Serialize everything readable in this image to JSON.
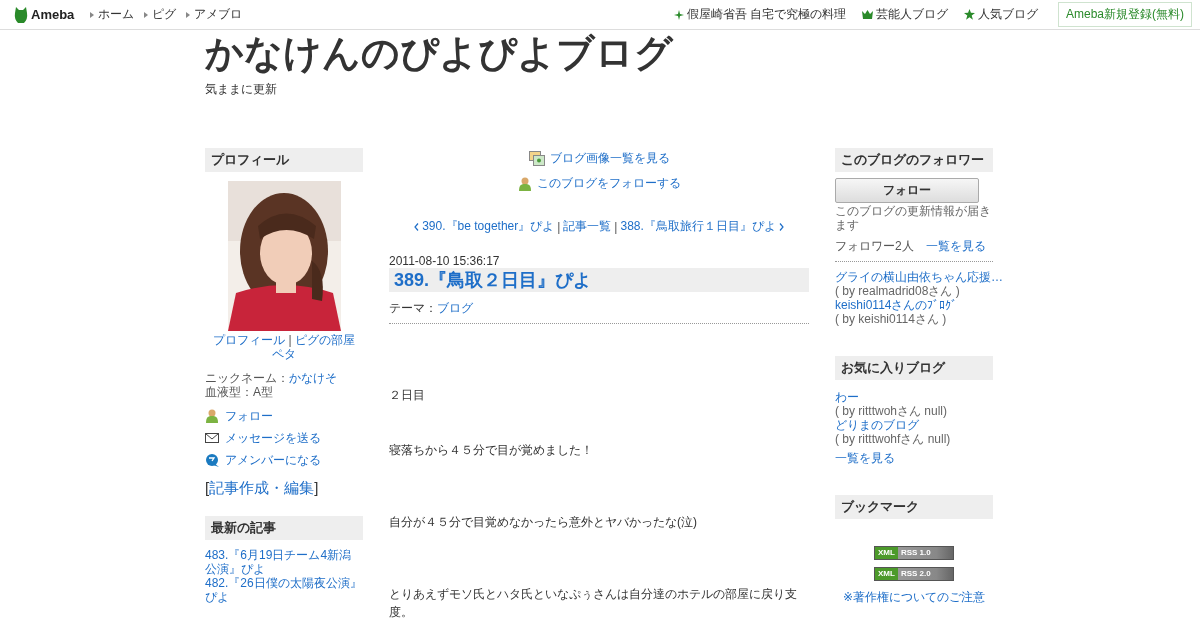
{
  "top_bar": {
    "logo": "Ameba",
    "nav": [
      "ホーム",
      "ピグ",
      "アメブロ"
    ],
    "links": [
      {
        "kind": "sparkle",
        "label": "假屋崎省吾 自宅で究極の料理"
      },
      {
        "kind": "crown",
        "label": "芸能人ブログ"
      },
      {
        "kind": "star",
        "label": "人気ブログ"
      }
    ],
    "signup": "Ameba新規登録(無料)"
  },
  "blog": {
    "title": "かなけんのぴよぴよブログ",
    "subtitle": "気ままに更新"
  },
  "profile": {
    "heading": "プロフィール",
    "photo": {
      "kind": "picture"
    },
    "links": [
      "プロフィール",
      "ピグの部屋"
    ],
    "separator": "|",
    "peta": "ペタ",
    "nickname_label": "ニックネーム：",
    "nickname": "かなけそ",
    "blood": "血液型：A型",
    "actions": [
      {
        "kind": "follow",
        "label": "フォロー"
      },
      {
        "kind": "message",
        "label": "メッセージを送る"
      },
      {
        "kind": "amember",
        "label": "アメンバーになる"
      }
    ],
    "edit": {
      "open": "[",
      "label": "記事作成・編集",
      "close": "]"
    }
  },
  "latest": {
    "heading": "最新の記事",
    "items": [
      "483.『6月19日チーム4新潟公演』ぴよ",
      "482.『26日僕の太陽夜公演』ぴよ"
    ]
  },
  "center": {
    "image_list_link": "ブログ画像一覧を見る",
    "follow_link": "このブログをフォローする",
    "pager": {
      "prev": "390.『be together』ぴよ",
      "separator": "|",
      "index": "記事一覧",
      "next": "388.『鳥取旅行１日目』ぴよ"
    },
    "post": {
      "date": "2011-08-10 15:36:17",
      "title": "389.『鳥取２日目』ぴよ",
      "theme_label": "テーマ：",
      "theme": "ブログ",
      "paragraphs": [
        "２日目",
        "寝落ちから４５分で目が覚めました！",
        "自分が４５分で目覚めなかったら意外とヤバかったな(泣)",
        "とりあえずモソ氏とハタ氏といなぷぅさんは自分達のホテルの部屋に戻り支度。"
      ]
    }
  },
  "followers": {
    "heading": "このブログのフォロワー",
    "button": "フォロー",
    "note": "このブログの更新情報が届きます",
    "count": "フォロワー2人",
    "see_all": "一覧を見る",
    "items": [
      {
        "title": "グライの横山由依ちゃん応援…",
        "by": "( by realmadrid08さん )"
      },
      {
        "title": "keishi0114さんのﾌﾞﾛｸﾞ",
        "by": "( by keishi0114さん )"
      }
    ]
  },
  "favorites": {
    "heading": "お気に入りブログ",
    "items": [
      {
        "title": "わー",
        "by": "( by ritttwohさん null)"
      },
      {
        "title": "どりまのブログ",
        "by": "( by ritttwohfさん null)"
      }
    ],
    "see_all": "一覧を見る"
  },
  "bookmarks": {
    "heading": "ブックマーク",
    "feeds": [
      {
        "xml": "XML",
        "rss": "RSS 1.0"
      },
      {
        "xml": "XML",
        "rss": "RSS 2.0"
      }
    ],
    "copyright": "※著作権についてのご注意"
  }
}
